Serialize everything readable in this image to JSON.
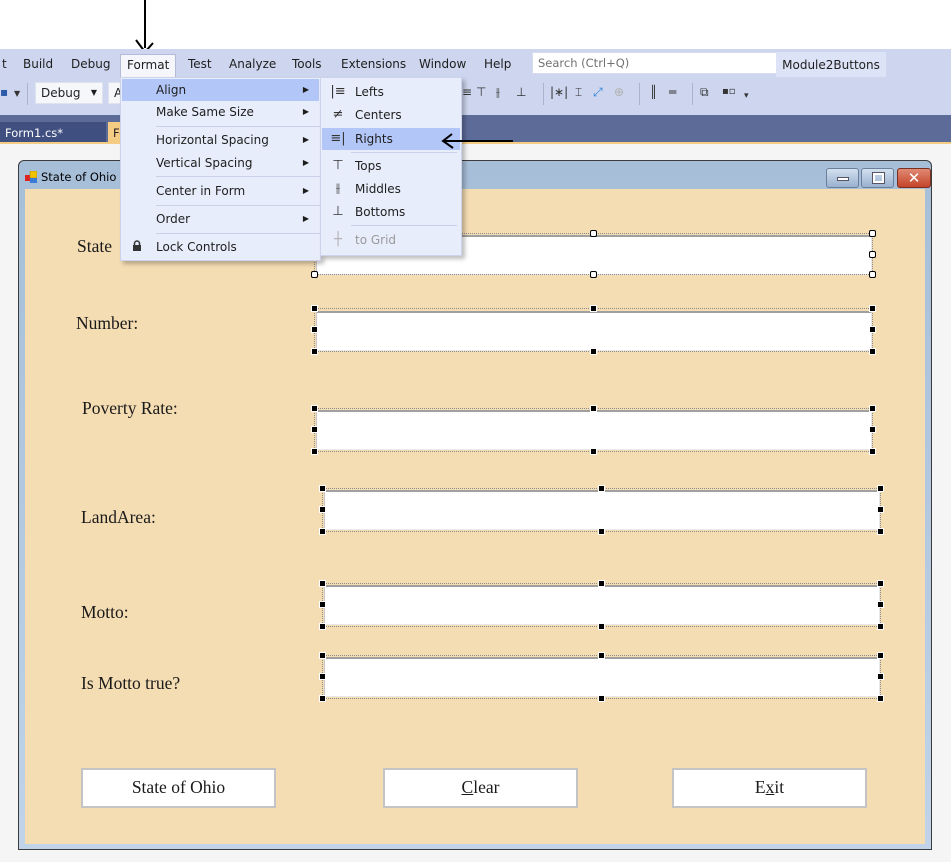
{
  "menubar": {
    "items": [
      {
        "label": "t",
        "active": false
      },
      {
        "label": "Build",
        "active": false
      },
      {
        "label": "Debug",
        "active": false
      },
      {
        "label": "Format",
        "active": true
      },
      {
        "label": "Test",
        "active": false
      },
      {
        "label": "Analyze",
        "active": false
      },
      {
        "label": "Tools",
        "active": false
      },
      {
        "label": "Extensions",
        "active": false
      },
      {
        "label": "Window",
        "active": false
      },
      {
        "label": "Help",
        "active": false
      }
    ],
    "search_placeholder": "Search (Ctrl+Q)",
    "search_icon": "magnifier-icon",
    "solution_name": "Module2Buttons"
  },
  "toolbar": {
    "config_combo": "Debug",
    "platform_combo": "A"
  },
  "tabs": [
    {
      "label": "Form1.cs*",
      "active": false
    },
    {
      "label": "Fo",
      "active": true
    }
  ],
  "format_menu": {
    "items": [
      {
        "label": "Align",
        "has_submenu": true,
        "highlighted": true
      },
      {
        "label": "Make Same Size",
        "has_submenu": true
      },
      {
        "label": "Horizontal Spacing",
        "has_submenu": true
      },
      {
        "label": "Vertical Spacing",
        "has_submenu": true
      },
      {
        "label": "Center in Form",
        "has_submenu": true
      },
      {
        "label": "Order",
        "has_submenu": true
      },
      {
        "label": "Lock Controls",
        "has_submenu": false,
        "icon": "lock-icon"
      }
    ]
  },
  "align_menu": {
    "items": [
      {
        "label": "Lefts",
        "icon": "align-lefts-icon"
      },
      {
        "label": "Centers",
        "icon": "align-centers-icon"
      },
      {
        "label": "Rights",
        "icon": "align-rights-icon",
        "highlighted": true
      },
      {
        "label": "Tops",
        "icon": "align-tops-icon"
      },
      {
        "label": "Middles",
        "icon": "align-middles-icon"
      },
      {
        "label": "Bottoms",
        "icon": "align-bottoms-icon"
      },
      {
        "label": "to Grid",
        "icon": "align-to-grid-icon",
        "disabled": true
      }
    ]
  },
  "form": {
    "title": "State of Ohio",
    "labels": {
      "state": "State",
      "number": "Number:",
      "poverty_rate": "Poverty Rate:",
      "land_area": "LandArea:",
      "motto": "Motto:",
      "motto_true": "Is Motto true?"
    },
    "textboxes": {
      "state": "",
      "number": "",
      "poverty_rate": "",
      "land_area": "",
      "motto": "",
      "motto_true": ""
    },
    "buttons": {
      "state_of_ohio": "State of Ohio",
      "clear_access_key": "C",
      "clear_rest": "lear",
      "exit_pre": "E",
      "exit_access_key": "x",
      "exit_rest": "it"
    }
  }
}
